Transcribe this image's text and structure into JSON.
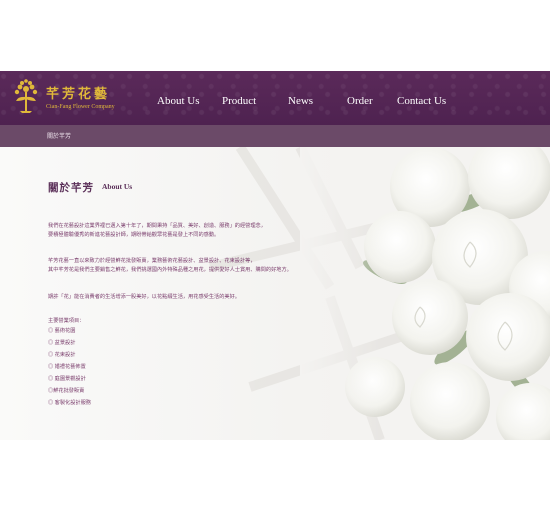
{
  "brand": {
    "name": "芊芳花藝",
    "subtitle": "Cian-Fang Flower Company",
    "logo_icon": "flower-logo-icon",
    "colors": {
      "header": "#5b2a5a",
      "gold": "#e0b83a",
      "text": "#7a3d6c"
    }
  },
  "nav": {
    "items": [
      {
        "label": "About Us"
      },
      {
        "label": "Product"
      },
      {
        "label": "News"
      },
      {
        "label": "Order"
      },
      {
        "label": "Contact Us"
      }
    ]
  },
  "breadcrumb": {
    "current": "關於芊芳"
  },
  "main": {
    "title_zh": "關於芊芳",
    "title_en": "About Us",
    "paragraphs": [
      [
        "我們在花藝設計這業界裡已邁入第十年了，期間秉持「品質、美好、創造、服務」的經營理念，",
        "要積極體驗優秀的新進花藝設計師，期盼帶給觀眾花藝是發上不同的感動。"
      ],
      [
        "芊芳花藝一直以來致力於經營鮮花批發販賣，業務藝術花藝設計、盆景設計、花束設計等，",
        "其中芊芳花是我們主要銷售之鮮花，我們挑選國內外特殊品種之用花，提供愛好人士賞用、購問的好地方。"
      ],
      [
        "期許「花」能在消費者的生活增添一股美好，以花點綴生活，用花感受生活的美好。"
      ]
    ],
    "services_title": "主要營業項目：",
    "services": [
      "◎ 藝術花園",
      "◎ 盆景設計",
      "◎ 花束設計",
      "◎ 婚禮花藝佈置",
      "◎ 庭園景觀設計",
      "◎鮮花批發販賣",
      "◎ 客製化設計服務"
    ]
  }
}
